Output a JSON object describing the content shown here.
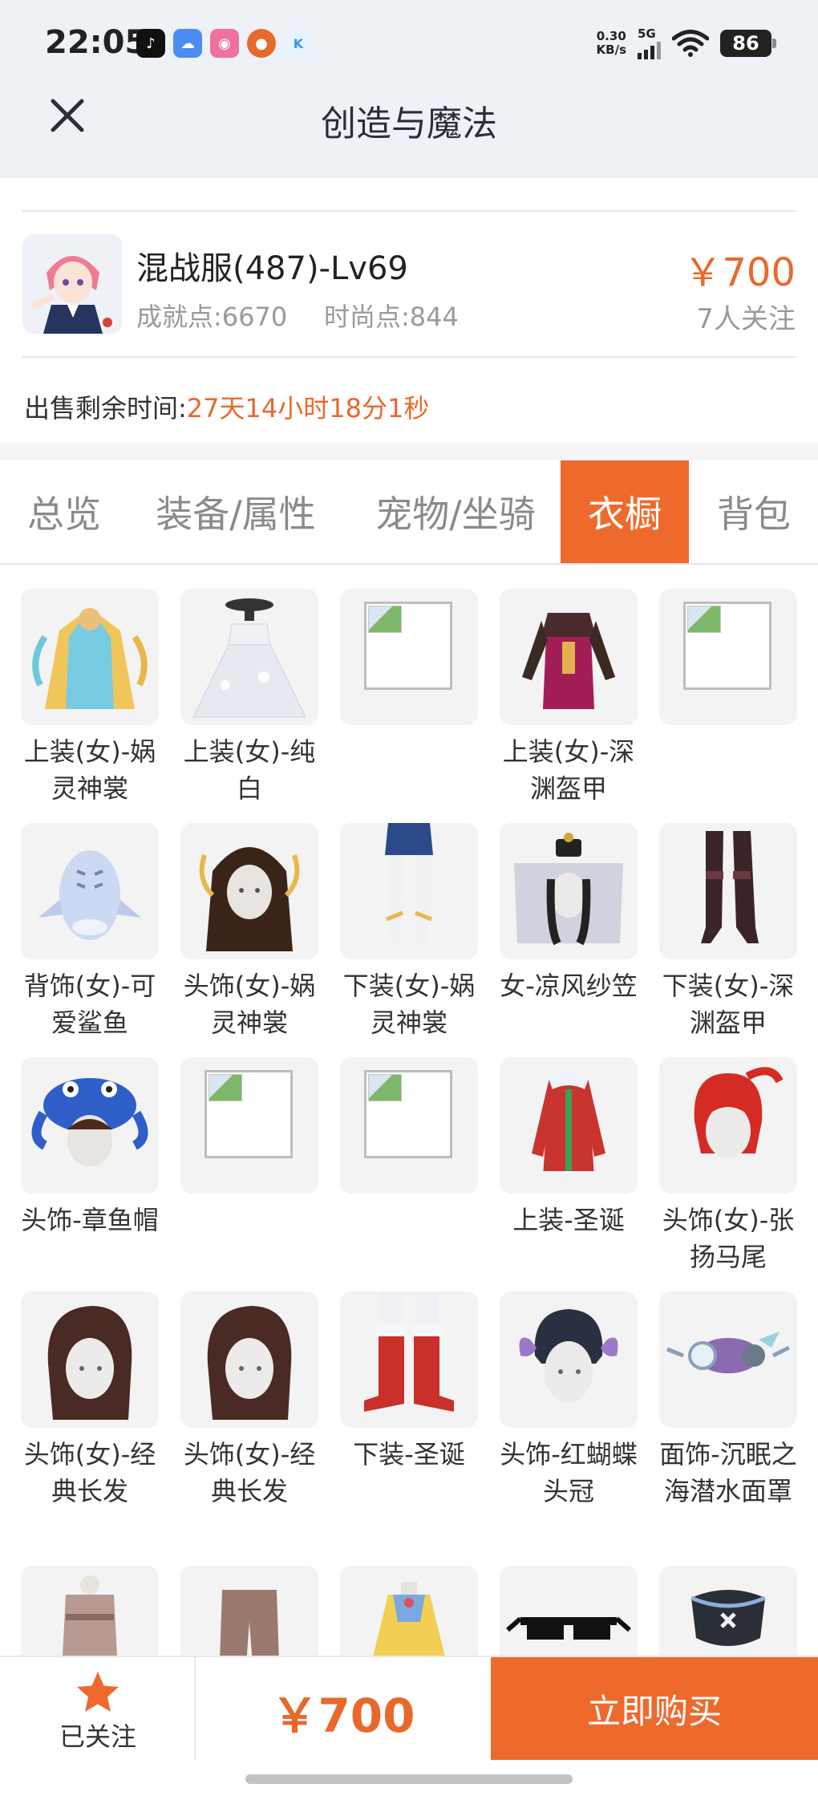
{
  "status_bar": {
    "time": "22:05",
    "net_speed_value": "0.30",
    "net_speed_unit": "KB/s",
    "network": "5G",
    "battery": "86"
  },
  "header": {
    "title": "创造与魔法"
  },
  "item": {
    "name": "混战服(487)-Lv69",
    "achievement": "成就点:6670",
    "fashion": "时尚点:844",
    "price": "￥700",
    "followers": "7人关注",
    "sale_time_label": "出售剩余时间:",
    "sale_time_value": "27天14小时18分1秒"
  },
  "tabs": [
    {
      "label": "总览"
    },
    {
      "label": "装备/属性"
    },
    {
      "label": "宠物/坐骑"
    },
    {
      "label": "衣橱"
    },
    {
      "label": "背包"
    }
  ],
  "wardrobe": [
    {
      "label": "上装(女)-娲灵神裳",
      "icon": "robe-gold-icon"
    },
    {
      "label": "上装(女)-纯白",
      "icon": "white-dress-icon"
    },
    {
      "label": "",
      "icon": "broken-image-icon"
    },
    {
      "label": "上装(女)-深渊盔甲",
      "icon": "armor-icon"
    },
    {
      "label": "",
      "icon": "broken-image-icon"
    },
    {
      "label": "背饰(女)-可爱鲨鱼",
      "icon": "shark-icon"
    },
    {
      "label": "头饰(女)-娲灵神裳",
      "icon": "gold-hair-icon"
    },
    {
      "label": "下装(女)-娲灵神裳",
      "icon": "legs-icon"
    },
    {
      "label": "女-凉风纱笠",
      "icon": "veil-hat-icon"
    },
    {
      "label": "下装(女)-深渊盔甲",
      "icon": "boots-icon"
    },
    {
      "label": "头饰-章鱼帽",
      "icon": "octopus-hat-icon"
    },
    {
      "label": "",
      "icon": "broken-image-icon"
    },
    {
      "label": "",
      "icon": "broken-image-icon"
    },
    {
      "label": "上装-圣诞",
      "icon": "christmas-coat-icon"
    },
    {
      "label": "头饰(女)-张扬马尾",
      "icon": "red-hair-icon"
    },
    {
      "label": "头饰(女)-经典长发",
      "icon": "brown-hair-icon"
    },
    {
      "label": "头饰(女)-经典长发",
      "icon": "brown-hair-icon"
    },
    {
      "label": "下装-圣诞",
      "icon": "christmas-boots-icon"
    },
    {
      "label": "头饰-红蝴蝶头冠",
      "icon": "butterfly-crown-icon"
    },
    {
      "label": "面饰-沉眠之海潜水面罩",
      "icon": "diving-mask-icon"
    },
    {
      "label": "",
      "icon": "shirt-icon"
    },
    {
      "label": "",
      "icon": "pants-icon"
    },
    {
      "label": "",
      "icon": "yellow-dress-icon"
    },
    {
      "label": "",
      "icon": "sunglasses-icon"
    },
    {
      "label": "",
      "icon": "face-mask-icon"
    }
  ],
  "bottom_bar": {
    "follow_label": "已关注",
    "price": "￥700",
    "buy_label": "立即购买"
  },
  "colors": {
    "accent": "#ee6a2c",
    "price": "#e8692b",
    "header_bg": "#eef2f7"
  }
}
